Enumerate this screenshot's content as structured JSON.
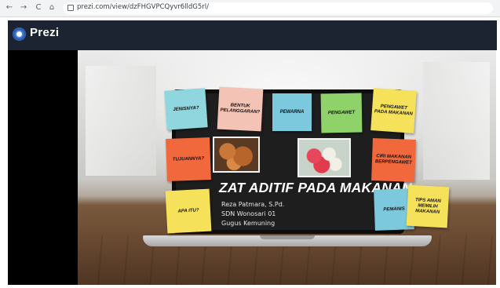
{
  "browser": {
    "url": "prezi.com/view/dzFHGVPCQyvr6lldG5rl/",
    "back_glyph": "←",
    "forward_glyph": "→",
    "reload_glyph": "C",
    "home_glyph": "⌂"
  },
  "app": {
    "name": "Prezi",
    "header_color": "#1c2331"
  },
  "slide": {
    "title": "ZAT ADITIF PADA MAKANAN",
    "author": "Reza Patmara, S.Pd.",
    "school": "SDN Wonosari 01",
    "group": "Gugus Kemuning",
    "sticky_notes": [
      {
        "text": "JENISNYA?",
        "color": "#8fd6de"
      },
      {
        "text": "BENTUK PELANGGARAN?",
        "color": "#f3c3b5"
      },
      {
        "text": "PEWARNA",
        "color": "#7cc8dc"
      },
      {
        "text": "PENGAWET",
        "color": "#8fd26a"
      },
      {
        "text": "PENGAWET PADA MAKANAN",
        "color": "#f6e25a"
      },
      {
        "text": "TUJUANNYA?",
        "color": "#f2683d"
      },
      {
        "text": "CIRI MAKANAN BERPENGAWET",
        "color": "#f2683d"
      },
      {
        "text": "APA ITU?",
        "color": "#f6e25a"
      },
      {
        "text": "PEMANIS",
        "color": "#7cc8dc"
      },
      {
        "text": "TIPS AMAN MEMILIH MAKANAN",
        "color": "#f6e25a"
      }
    ]
  }
}
